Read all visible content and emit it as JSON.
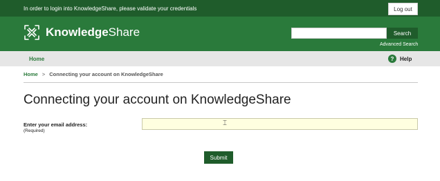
{
  "topbar": {
    "notice": "In order to login into KnowledgeShare, please validate your credentials",
    "logout_label": "Log out"
  },
  "brand": {
    "name_bold": "Knowledge",
    "name_regular": "Share",
    "logo_icon": "knowledgeshare-logo-icon"
  },
  "search": {
    "value": "",
    "button_label": "Search",
    "advanced_label": "Advanced Search"
  },
  "nav": {
    "home_label": "Home",
    "help_icon_glyph": "?",
    "help_label": "Help"
  },
  "breadcrumb": {
    "home": "Home",
    "separator": ">",
    "current": "Connecting your account on KnowledgeShare"
  },
  "page": {
    "title": "Connecting your account on KnowledgeShare"
  },
  "form": {
    "email_label": "Enter your email address:",
    "email_required": "(Required)",
    "email_value": "",
    "submit_label": "Submit"
  },
  "colors": {
    "topbar": "#1f5c2b",
    "brandbar": "#2a7a3b",
    "navbar": "#e6e6e6",
    "input_highlight": "#ffffe0"
  }
}
